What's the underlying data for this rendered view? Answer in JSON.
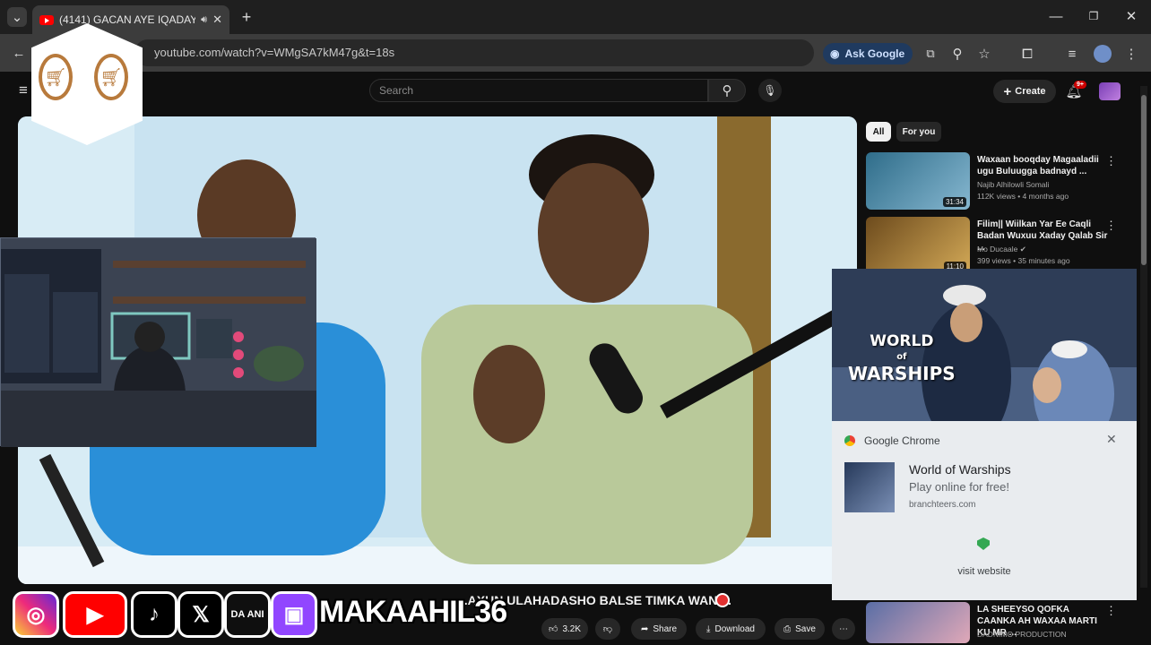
{
  "browser": {
    "tab_title": "(4141) GACAN AYE IQADAY",
    "url": "youtube.com/watch?v=WMgSA7kM47g&t=18s",
    "ask_google": "Ask Google"
  },
  "youtube": {
    "search_placeholder": "Search",
    "create_label": "Create",
    "notification_count": "9+",
    "chips": [
      "All",
      "For you"
    ],
    "video_title": "...AXUN ULAHADASHO BALSE TIMKA WAN ...",
    "actions": {
      "likes": "3.2K",
      "share": "Share",
      "download": "Download",
      "save": "Save"
    },
    "recommendations": [
      {
        "title": "Waxaan booqday Magaaladii ugu Buluugga badnayd ...",
        "channel": "Najib Alhilowli Somali",
        "meta": "112K views • 4 months ago",
        "duration": "31:34",
        "colors": [
          "#3b7a9c",
          "#5aa0c0"
        ]
      },
      {
        "title": "Filim|| Wiilkan Yar Ee Caqli Badan Wuxuu Xaday Qalab Sir ...",
        "channel": "Mo Ducaale",
        "meta": "399 views • 35 minutes ago",
        "duration": "11:10",
        "colors": [
          "#7a5a2a",
          "#c29a4a"
        ]
      },
      {
        "title": "LA SHEEYSO QOFKA CAANKA AH WAXAA MARTI KU MR ...",
        "channel": "DADNIMO PRODUCTION",
        "meta": "",
        "duration": "",
        "colors": [
          "#6a7fb0",
          "#d9a0b0"
        ]
      }
    ]
  },
  "notification": {
    "app": "Google Chrome",
    "title": "World of Warships",
    "subtitle": "Play online for free!",
    "domain": "branchteers.com",
    "action": "visit website",
    "ad_logo_line1": "WORLD",
    "ad_logo_line2": "WARSHIPS",
    "ad_logo_small": "of"
  },
  "overlay": {
    "handle": "MAKAAHIL36",
    "partial_text": "DA ANI"
  }
}
